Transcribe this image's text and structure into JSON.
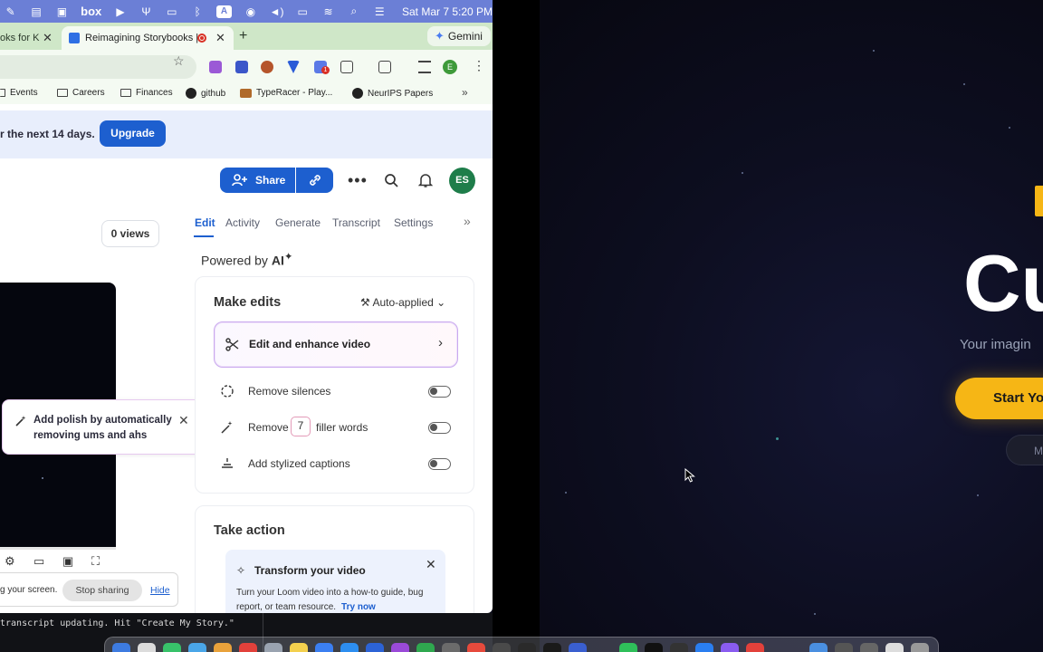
{
  "menubar": {
    "box_logo": "box",
    "ai_badge": "A",
    "clock": "Sat Mar 7  5:20 PM"
  },
  "browser": {
    "tabs": [
      {
        "label": "oks for K"
      },
      {
        "label": "Reimagining Storybooks |"
      }
    ],
    "new_tab": "+",
    "gemini_label": "Gemini",
    "ext_badge": "1",
    "profile_initial": "E",
    "bookmarks": [
      {
        "label": "Events"
      },
      {
        "label": "Careers"
      },
      {
        "label": "Finances"
      },
      {
        "label": "github"
      },
      {
        "label": "TypeRacer - Play..."
      },
      {
        "label": "NeurIPS Papers"
      }
    ]
  },
  "loom": {
    "trial_text": "r the next 14 days.",
    "upgrade_label": "Upgrade",
    "share_label": "Share",
    "user_initials": "ES",
    "views_label": "0 views",
    "polish_tip": {
      "text": "Add polish by automatically removing ums and ahs"
    },
    "stop_bar": {
      "text": "g your screen.",
      "stop_label": "Stop sharing",
      "hide_label": "Hide"
    },
    "panel_tabs": [
      {
        "label": "Edit"
      },
      {
        "label": "Activity"
      },
      {
        "label": "Generate"
      },
      {
        "label": "Transcript"
      },
      {
        "label": "Settings"
      }
    ],
    "powered_by_prefix": "Powered by ",
    "powered_by_brand": "AI",
    "make_edits": {
      "title": "Make edits",
      "mode": "Auto-applied",
      "enhance_label": "Edit and enhance video",
      "options": [
        {
          "label": "Remove silences",
          "enabled": false
        },
        {
          "label_before": "Remove",
          "count": "7",
          "label_after": "filler words",
          "enabled": false
        },
        {
          "label": "Add stylized captions",
          "enabled": false
        }
      ]
    },
    "take_action": {
      "title": "Take action",
      "transform_title": "Transform your video",
      "transform_desc": "Turn your Loom video into a how-to guide, bug report, or team resource.",
      "try_now": "Try now"
    }
  },
  "hero": {
    "title": "Cu",
    "subtitle": "Your imagin",
    "start_label": "Start Yo",
    "more_label": "M"
  },
  "terminal": {
    "line": "transcript updating. Hit \"Create My Story.\""
  },
  "colors": {
    "menubar": "#6b7fd6",
    "tabbar": "#cfe7c8",
    "loom_blue": "#1d5fcf",
    "hero_yellow": "#f6b615"
  }
}
